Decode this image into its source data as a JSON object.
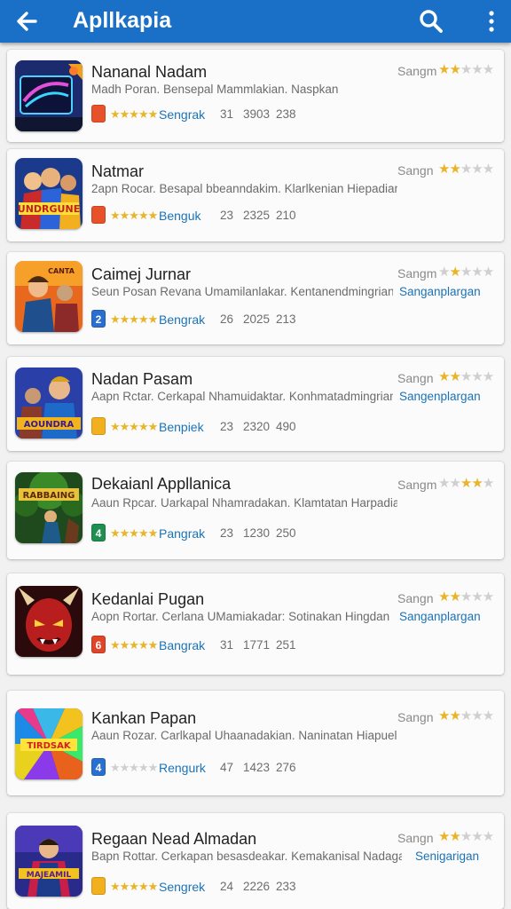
{
  "app_bar": {
    "title": "Apllkapia",
    "color": "#1a6fc6"
  },
  "apps": [
    {
      "name": "Nananal Nadam",
      "description": "Madh Poran. Bensepal Mammlakian. Naspkan",
      "rank_label": "Sangm",
      "rating": 2,
      "tag": "",
      "badge": {
        "text": "",
        "color": "#e8522a"
      },
      "meta_stars": 5,
      "status": "Sengrak",
      "numbers": [
        "31",
        "3903",
        "238"
      ],
      "icon": "neon-screen-icon"
    },
    {
      "name": "Natmar",
      "description": "2apn Rocar. Besapal bbeanndakim. Klarlkenian Hiepadian",
      "rank_label": "Sangn",
      "rating": 2,
      "tag": "",
      "badge": {
        "text": "",
        "color": "#e8522a"
      },
      "meta_stars": 5,
      "status": "Benguk",
      "numbers": [
        "23",
        "2325",
        "210"
      ],
      "icon": "superhero-team-icon"
    },
    {
      "name": "Caimej Jurnar",
      "description": "Seun Posan Revana Umamilanlakar. Kentanendmingrian",
      "rank_label": "Sangm",
      "rating": 2,
      "tag": "Sanganplargan",
      "badge": {
        "text": "2",
        "color": "#2a6fd0"
      },
      "meta_stars": 5,
      "status": "Bengrak",
      "numbers": [
        "26",
        "2025",
        "213"
      ],
      "icon": "heroes-battle-icon"
    },
    {
      "name": "Nadan Pasam",
      "description": "Aapn Rctar. Cerkapal Nhamuidaktar. Konhmatadmingrian",
      "rank_label": "Sangn",
      "rating": 2,
      "tag": "Sangenplargan",
      "badge": {
        "text": "",
        "color": "#f2b01e"
      },
      "meta_stars": 5,
      "status": "Benpiek",
      "numbers": [
        "23",
        "2320",
        "490"
      ],
      "icon": "arena-heroes-icon"
    },
    {
      "name": "Dekaianl Appllanica",
      "description": "Aaun Rpcar. Uarkapal Nhamradakan. Klamtatan Harpadian",
      "rank_label": "Sangm",
      "rating": 2,
      "tag": "",
      "badge": {
        "text": "4",
        "color": "#1e8f4e"
      },
      "meta_stars": 5,
      "status": "Pangrak",
      "numbers": [
        "23",
        "1230",
        "250"
      ],
      "icon": "jungle-adventure-icon"
    },
    {
      "name": "Kedanlai Pugan",
      "description": "Aopn Rortar. Cerlana UMamiakadar: Sotinakan Hingdan",
      "rank_label": "Sangn",
      "rating": 2,
      "tag": "Sanganplargan",
      "badge": {
        "text": "6",
        "color": "#e0452a"
      },
      "meta_stars": 5,
      "status": "Bangrak",
      "numbers": [
        "31",
        "1771",
        "251"
      ],
      "icon": "demon-face-icon"
    },
    {
      "name": "Kankan Papan",
      "description": "Aaun Rozar. Carlkapal Uhaanadakian. Naninatan Hiapuelan",
      "rank_label": "Sangn",
      "rating": 2,
      "tag": "",
      "badge": {
        "text": "4",
        "color": "#2a6fd0"
      },
      "meta_stars": 0,
      "status": "Rengurk",
      "numbers": [
        "47",
        "1423",
        "276"
      ],
      "icon": "color-burst-icon"
    },
    {
      "name": "Regaan Nead Almadan",
      "description": "Bapn Rottar. Cerkapan besasdeakar. Kemakanisal Nadagan",
      "rank_label": "Sangn",
      "rating": 2,
      "tag": "Senigarigan",
      "badge": {
        "text": "",
        "color": "#f2b01e"
      },
      "meta_stars": 5,
      "status": "Sengrek",
      "numbers": [
        "24",
        "2226",
        "233"
      ],
      "icon": "caped-hero-icon"
    }
  ]
}
